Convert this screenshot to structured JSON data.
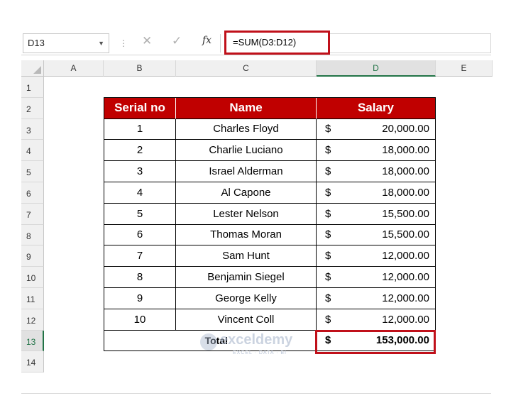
{
  "formula_bar": {
    "name_box": "D13",
    "formula": "=SUM(D3:D12)",
    "icons": [
      "dropdown-arrow",
      "more-dots",
      "cancel-x",
      "enter-check",
      "insert-function-fx"
    ]
  },
  "columns": [
    "A",
    "B",
    "C",
    "D",
    "E"
  ],
  "selected_column": "D",
  "rows": [
    "1",
    "2",
    "3",
    "4",
    "5",
    "6",
    "7",
    "8",
    "9",
    "10",
    "11",
    "12",
    "13",
    "14"
  ],
  "selected_row": "13",
  "table": {
    "headers": [
      "Serial no",
      "Name",
      "Salary"
    ],
    "records": [
      {
        "serial": "1",
        "name": "Charles Floyd",
        "currency": "$",
        "salary": "20,000.00"
      },
      {
        "serial": "2",
        "name": "Charlie Luciano",
        "currency": "$",
        "salary": "18,000.00"
      },
      {
        "serial": "3",
        "name": "Israel Alderman",
        "currency": "$",
        "salary": "18,000.00"
      },
      {
        "serial": "4",
        "name": "Al Capone",
        "currency": "$",
        "salary": "18,000.00"
      },
      {
        "serial": "5",
        "name": "Lester Nelson",
        "currency": "$",
        "salary": "15,500.00"
      },
      {
        "serial": "6",
        "name": "Thomas Moran",
        "currency": "$",
        "salary": "15,500.00"
      },
      {
        "serial": "7",
        "name": "Sam Hunt",
        "currency": "$",
        "salary": "12,000.00"
      },
      {
        "serial": "8",
        "name": "Benjamin Siegel",
        "currency": "$",
        "salary": "12,000.00"
      },
      {
        "serial": "9",
        "name": "George Kelly",
        "currency": "$",
        "salary": "12,000.00"
      },
      {
        "serial": "10",
        "name": "Vincent Coll",
        "currency": "$",
        "salary": "12,000.00"
      }
    ],
    "total_label": "Total",
    "total_currency": "$",
    "total_value": "153,000.00"
  },
  "watermark": {
    "brand": "exceldemy",
    "tagline": "EXCEL · DATA · BI"
  },
  "colors": {
    "header_fill": "#c00000",
    "highlight_border": "#c0101a",
    "selection_green": "#217346"
  }
}
